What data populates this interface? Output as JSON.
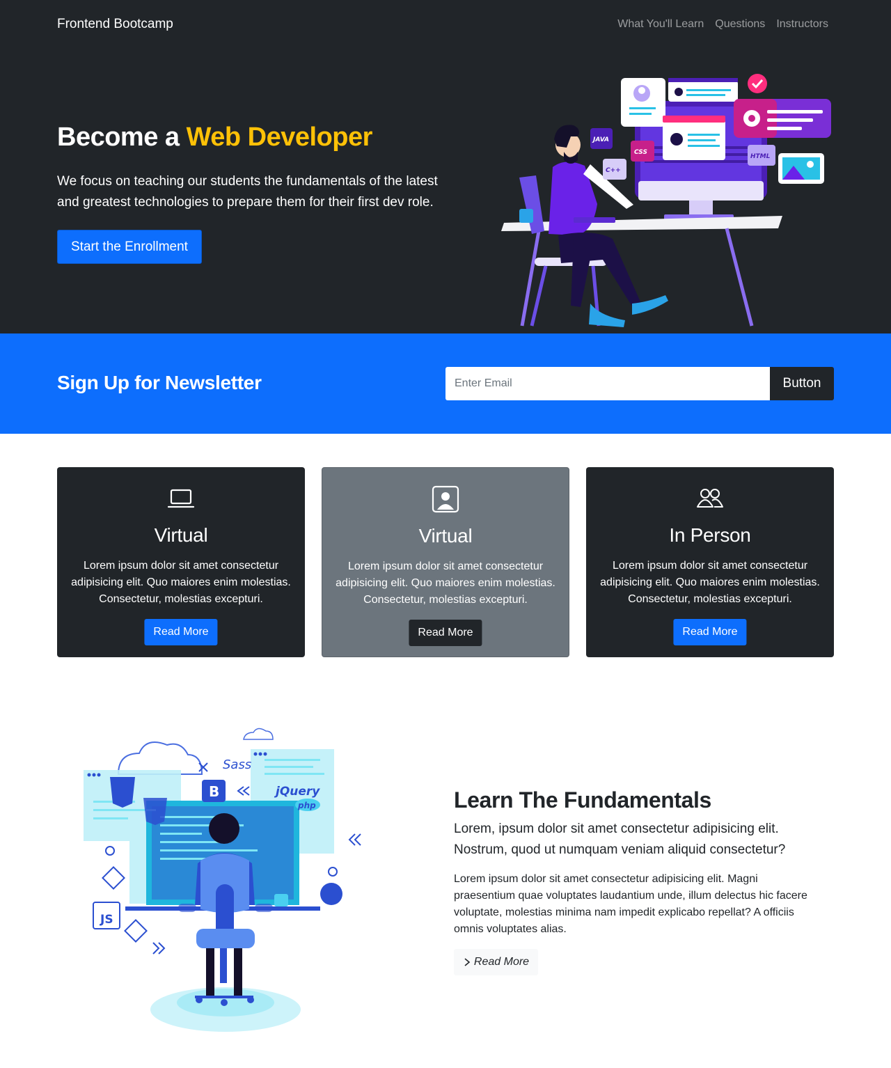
{
  "navbar": {
    "brand": "Frontend Bootcamp",
    "links": [
      "What You'll Learn",
      "Questions",
      "Instructors"
    ]
  },
  "hero": {
    "title_prefix": "Become a ",
    "title_accent": "Web Developer",
    "lead": "We focus on teaching our students the fundamentals of the latest and greatest technologies to prepare them for their first dev role.",
    "cta_label": "Start the Enrollment",
    "illustration_labels": [
      "JAVA",
      "CSS",
      "C++",
      "HTML"
    ]
  },
  "newsletter": {
    "title": "Sign Up for Newsletter",
    "input_placeholder": "Enter Email",
    "button_label": "Button"
  },
  "cards": [
    {
      "icon": "laptop-icon",
      "title": "Virtual",
      "text": "Lorem ipsum dolor sit amet consectetur adipisicing elit. Quo maiores enim molestias. Consectetur, molestias excepturi.",
      "button": "Read More"
    },
    {
      "icon": "person-square-icon",
      "title": "Virtual",
      "text": "Lorem ipsum dolor sit amet consectetur adipisicing elit. Quo maiores enim molestias. Consectetur, molestias excepturi.",
      "button": "Read More"
    },
    {
      "icon": "people-icon",
      "title": "In Person",
      "text": "Lorem ipsum dolor sit amet consectetur adipisicing elit. Quo maiores enim molestias. Consectetur, molestias excepturi.",
      "button": "Read More"
    }
  ],
  "learn": {
    "title": "Learn The Fundamentals",
    "lead": "Lorem, ipsum dolor sit amet consectetur adipisicing elit. Nostrum, quod ut numquam veniam aliquid consectetur?",
    "text": "Lorem ipsum dolor sit amet consectetur adipisicing elit. Magni praesentium quae voluptates laudantium unde, illum delectus hic facere voluptate, molestias minima nam impedit explicabo repellat? A officiis omnis voluptates alias.",
    "button": "Read More",
    "illustration_labels": [
      "Sass",
      "B",
      "jQuery",
      "php",
      "JS"
    ]
  },
  "colors": {
    "dark": "#212529",
    "primary": "#0d6efd",
    "warning": "#ffc107",
    "secondary": "#6c757d",
    "light": "#f8f9fa"
  }
}
